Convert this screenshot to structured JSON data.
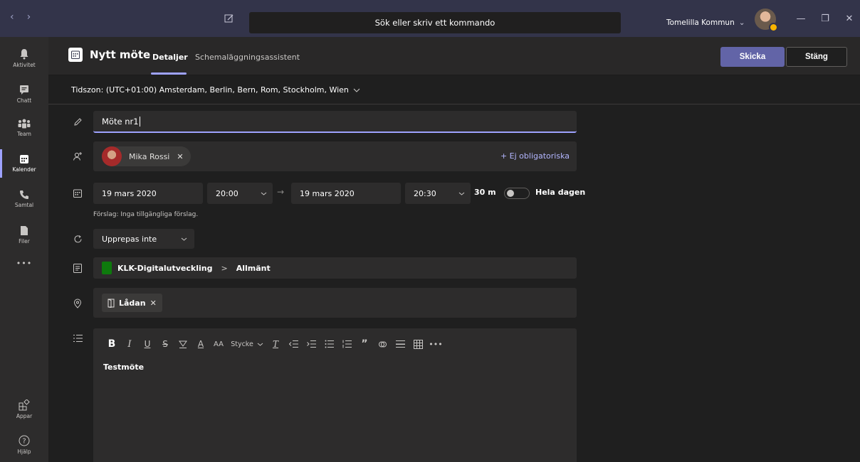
{
  "titlebar": {
    "search_placeholder": "Sök eller skriv ett kommando",
    "org_name": "Tomelilla Kommun",
    "org_chevron": "⌄"
  },
  "rail": {
    "items": [
      {
        "label": "Aktivitet",
        "icon": "bell-icon"
      },
      {
        "label": "Chatt",
        "icon": "chat-icon"
      },
      {
        "label": "Team",
        "icon": "team-icon"
      },
      {
        "label": "Kalender",
        "icon": "calendar-icon",
        "active": true
      },
      {
        "label": "Samtal",
        "icon": "phone-icon"
      },
      {
        "label": "Filer",
        "icon": "file-icon"
      },
      {
        "label": "Appar",
        "icon": "apps-icon"
      },
      {
        "label": "Hjälp",
        "icon": "help-icon"
      }
    ],
    "more": "•••"
  },
  "header": {
    "title": "Nytt möte",
    "tabs": [
      {
        "label": "Detaljer",
        "active": true
      },
      {
        "label": "Schemaläggningsassistent",
        "active": false
      }
    ],
    "send_label": "Skicka",
    "close_label": "Stäng"
  },
  "timezone": {
    "label": "Tidszon: (UTC+01:00) Amsterdam, Berlin, Bern, Rom, Stockholm, Wien"
  },
  "form": {
    "title_value": "Möte nr1",
    "attendee": {
      "name": "Mika Rossi",
      "remove": "✕"
    },
    "optional_link": "+ Ej obligatoriska",
    "start_date": "19 mars 2020",
    "start_time": "20:00",
    "end_date": "19 mars 2020",
    "end_time": "20:30",
    "duration": "30 m",
    "all_day_label": "Hela dagen",
    "all_day_on": false,
    "suggestion": "Förslag: Inga tillgängliga förslag.",
    "repeat": "Upprepas inte",
    "channel": {
      "team": "KLK-Digitalutveckling",
      "separator": ">",
      "channel": "Allmänt"
    },
    "location": {
      "name": "Lådan",
      "remove": "✕"
    },
    "editor": {
      "paragraph_style": "Stycke",
      "body": "Testmöte"
    }
  },
  "colors": {
    "accent": "#6264a7",
    "accent_light": "#9ea2ff",
    "titlebar": "#33344a",
    "background": "#1f1f1f",
    "field": "#2d2c2c"
  }
}
